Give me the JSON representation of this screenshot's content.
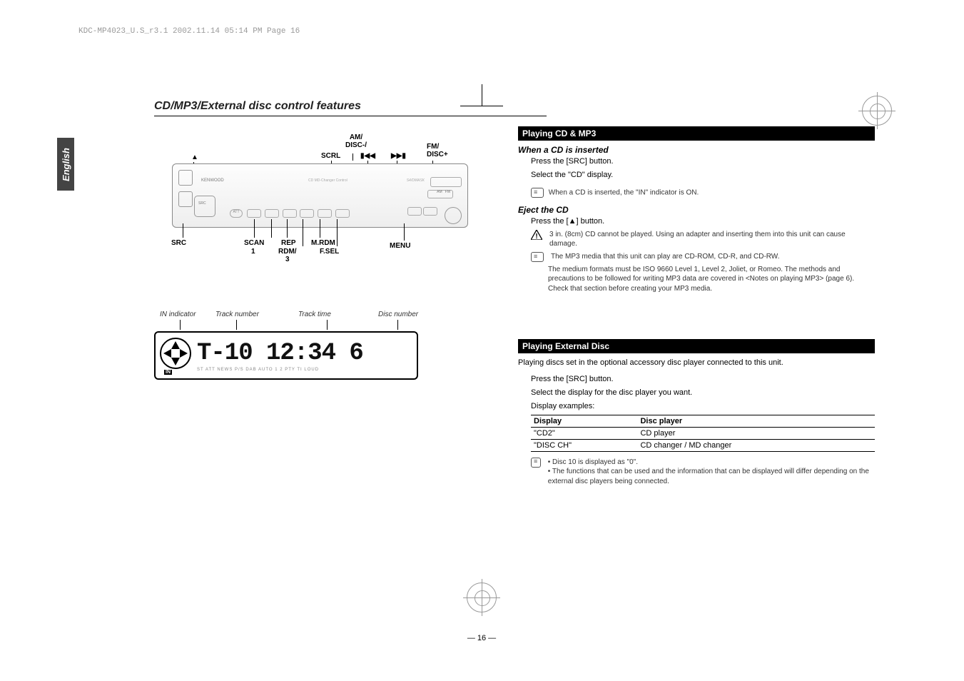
{
  "header_line": "KDC-MP4023_U.S_r3.1  2002.11.14  05:14 PM  Page 16",
  "sidetab": "English",
  "section_title": "CD/MP3/External disc control features",
  "faceplate_labels": {
    "eject": "▲",
    "scrl": "SCRL",
    "am_disc_minus": "AM/\nDISC-/",
    "rew": "▮◀◀",
    "ffw": "▶▶▮",
    "fm_disc_plus": "FM/\nDISC+",
    "src": "SRC",
    "scan": "SCAN",
    "one": "1",
    "rep": "REP",
    "rdm_3": "RDM/\n3",
    "mrdm": "M.RDM",
    "fsel": "F.SEL",
    "menu": "MENU"
  },
  "display_labels": {
    "in": "IN indicator",
    "track_no": "Track number",
    "track_time": "Track time",
    "disc_no": "Disc number"
  },
  "lcd": {
    "in": "IN",
    "main": "T-10   12:34  6",
    "bottom": "ST  ATT  NEWS  P/S  DAB  AUTO  1 2  PTY  TI  LOUD"
  },
  "right": {
    "cd_bar": "Playing CD & MP3",
    "when_cd": "When a CD is inserted",
    "press_src": "Press the [SRC] button.",
    "select_cd": "Select the \"CD\" display.",
    "note_in": "When a CD is inserted, the \"IN\" indicator is ON.",
    "eject_head": "Eject the CD",
    "press_eject": "Press the [▲] button.",
    "warn_3in": "3 in. (8cm) CD cannot be played. Using an adapter and inserting them into this unit can cause damage.",
    "note_mp3_media": "The MP3 media that this unit can play are CD-ROM, CD-R, and CD-RW.",
    "note_mp3_fmt": "The medium formats must be ISO 9660 Level 1, Level 2, Joliet, or Romeo. The methods and precautions to be followed for writing MP3 data are covered in <Notes on playing MP3> (page 6). Check that section before creating your MP3 media.",
    "ext_bar": "Playing External Disc",
    "ext_intro": "Playing discs set in the optional accessory disc player connected to this unit.",
    "ext_press_src": "Press the [SRC] button.",
    "ext_select": "Select the display for the disc player you want.",
    "ext_examples": "Display examples:",
    "table": {
      "h1": "Display",
      "h2": "Disc player",
      "r1c1": "\"CD2\"",
      "r1c2": "CD player",
      "r2c1": "\"DISC CH\"",
      "r2c2": "CD changer / MD changer"
    },
    "note_disc10": "Disc 10 is displayed as \"0\".",
    "note_funcs": "The functions that can be used and the information that can be displayed will differ depending on the external disc players being connected."
  },
  "page_number": "— 16 —"
}
